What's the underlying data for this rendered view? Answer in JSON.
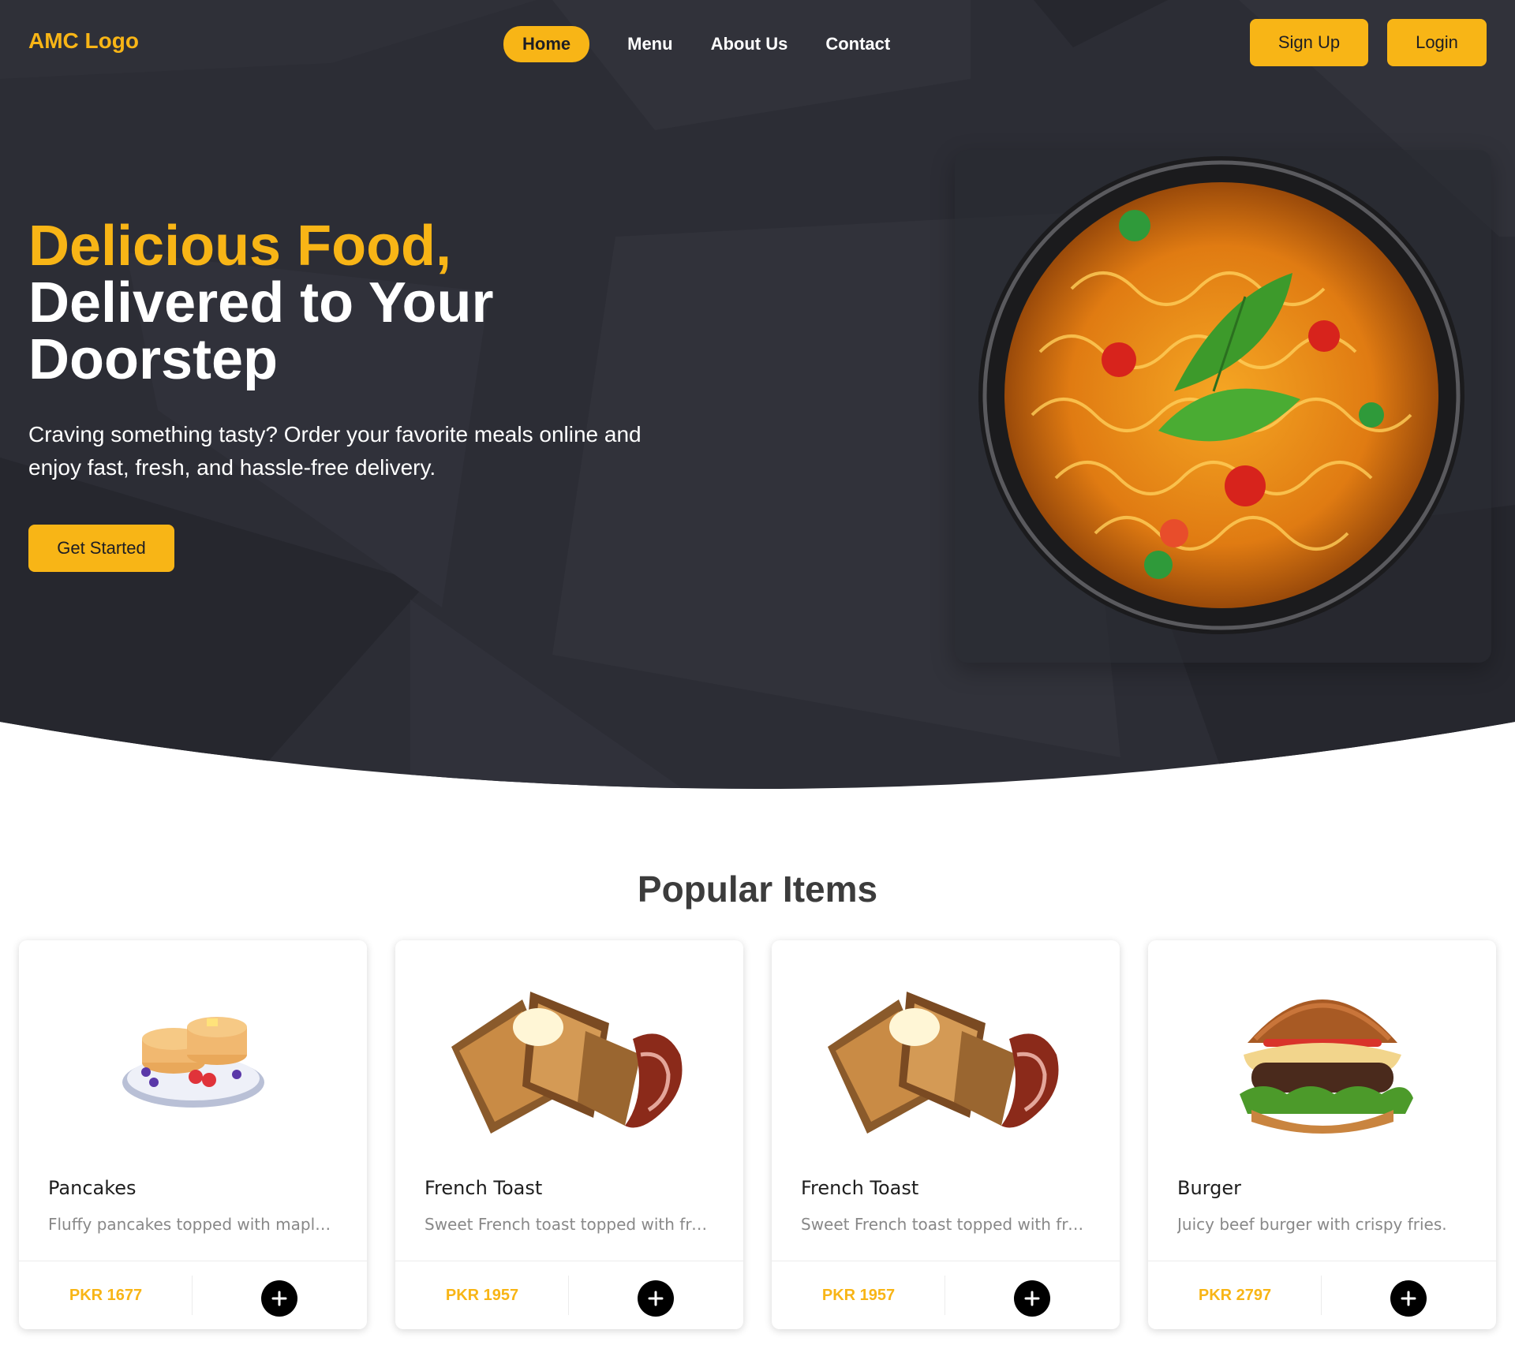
{
  "nav": {
    "logo": "AMC Logo",
    "links": [
      {
        "label": "Home",
        "active": true
      },
      {
        "label": "Menu",
        "active": false
      },
      {
        "label": "About Us",
        "active": false
      },
      {
        "label": "Contact",
        "active": false
      }
    ],
    "signup_label": "Sign Up",
    "login_label": "Login"
  },
  "hero": {
    "title_accent": "Delicious Food,",
    "title_line2": "Delivered to Your",
    "title_line3": "Doorstep",
    "subtitle": "Craving something tasty? Order your favorite meals online and enjoy fast, fresh, and hassle-free delivery.",
    "cta_label": "Get Started",
    "image_icon": "noodle-bowl-image"
  },
  "popular": {
    "title": "Popular Items",
    "items": [
      {
        "name": "Pancakes",
        "description": "Fluffy pancakes topped with maple sy...",
        "price": "PKR 1677",
        "image_icon": "pancakes-image"
      },
      {
        "name": "French Toast",
        "description": "Sweet French toast topped with fresh ...",
        "price": "PKR 1957",
        "image_icon": "french-toast-image"
      },
      {
        "name": "French Toast",
        "description": "Sweet French toast topped with fresh ...",
        "price": "PKR 1957",
        "image_icon": "french-toast-image"
      },
      {
        "name": "Burger",
        "description": "Juicy beef burger with crispy fries.",
        "price": "PKR 2797",
        "image_icon": "burger-image"
      }
    ],
    "add_icon": "plus-icon"
  },
  "colors": {
    "accent": "#f8b516",
    "hero_bg": "#2a2b33",
    "heading": "#3c3c3c"
  }
}
